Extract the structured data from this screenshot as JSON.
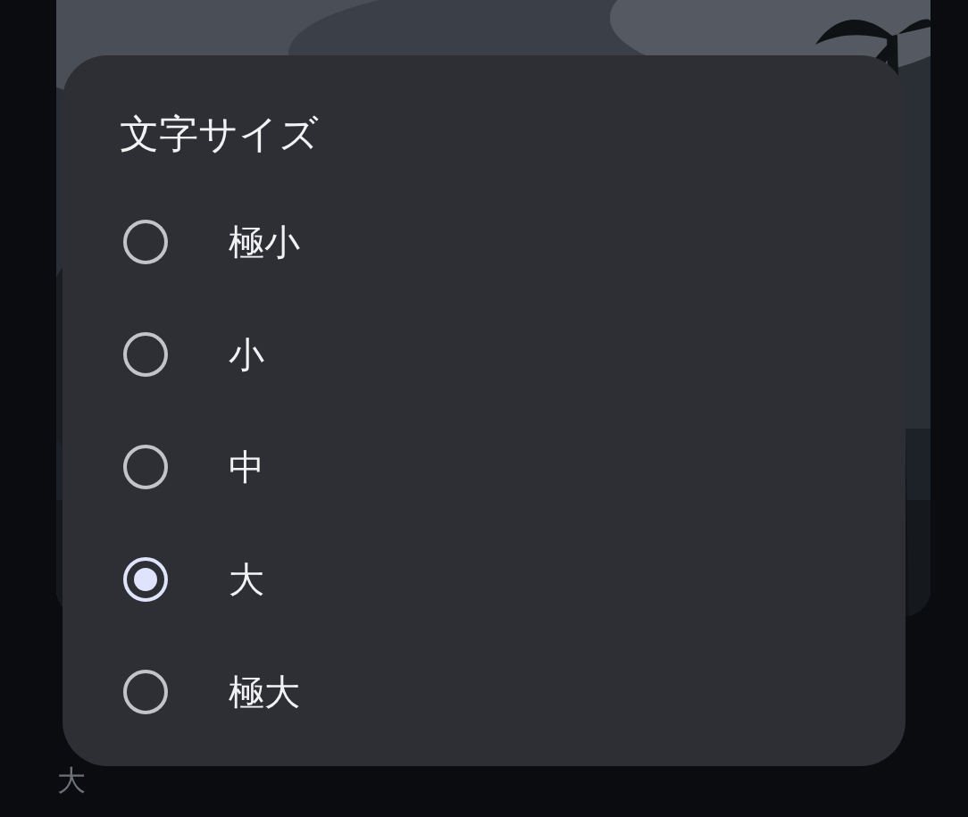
{
  "background": {
    "kind": "picture",
    "subtitle": "大"
  },
  "dialog": {
    "title": "文字サイズ",
    "options": [
      {
        "label": "極小",
        "selected": false
      },
      {
        "label": "小",
        "selected": false
      },
      {
        "label": "中",
        "selected": false
      },
      {
        "label": "大",
        "selected": true
      },
      {
        "label": "極大",
        "selected": false
      }
    ]
  }
}
